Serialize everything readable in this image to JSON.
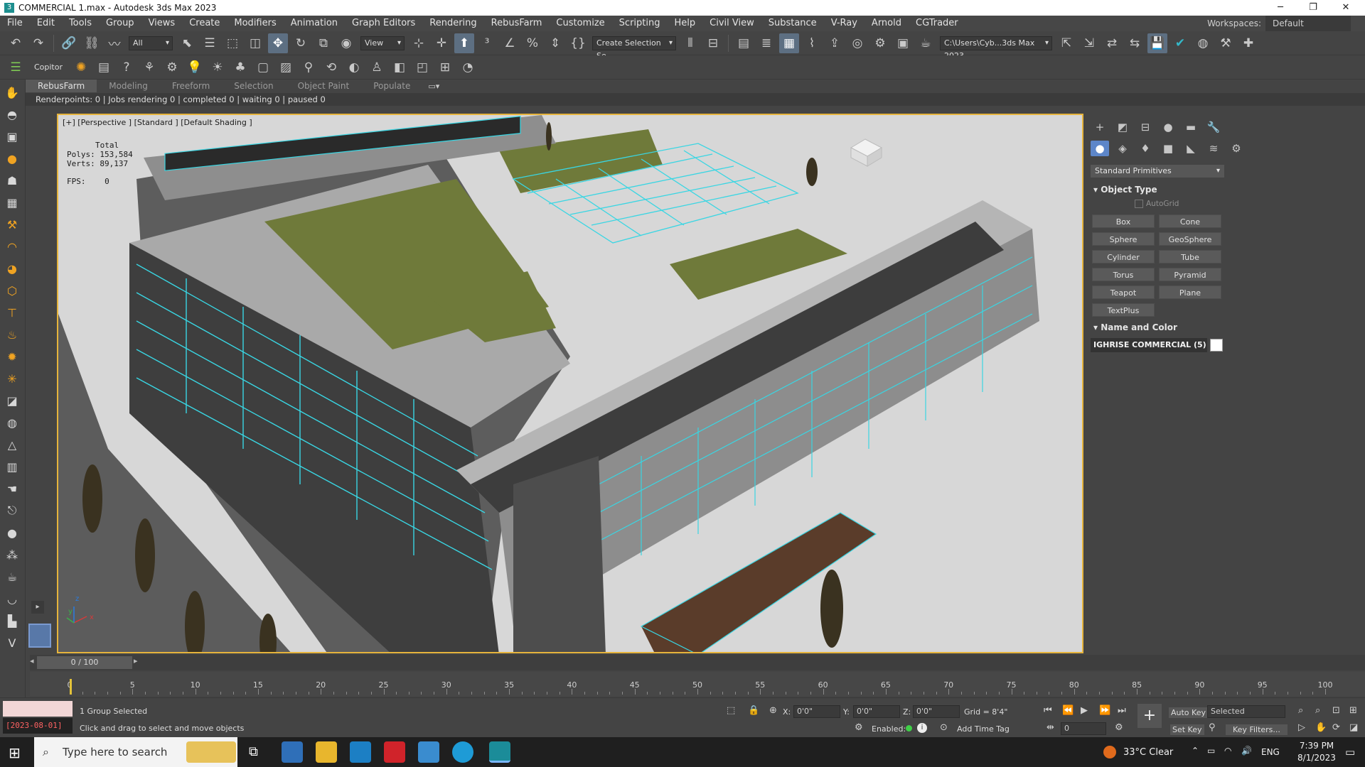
{
  "window": {
    "title": "COMMERCIAL 1.max - Autodesk 3ds Max 2023",
    "minimize_glyph": "─",
    "restore_glyph": "❐",
    "close_glyph": "✕"
  },
  "menu": {
    "items": [
      "File",
      "Edit",
      "Tools",
      "Group",
      "Views",
      "Create",
      "Modifiers",
      "Animation",
      "Graph Editors",
      "Rendering",
      "RebusFarm",
      "Customize",
      "Scripting",
      "Help",
      "Civil View",
      "Substance",
      "V-Ray",
      "Arnold",
      "CGTrader"
    ],
    "workspaces_label": "Workspaces:",
    "workspaces_value": "Default"
  },
  "main_toolbar": {
    "selection_filter": "All",
    "ref_coord": "View",
    "named_selection": "Create Selection Se",
    "project_path": "C:\\Users\\Cyb...3ds Max 2023"
  },
  "secondary_toolbar": {
    "copitor_label": "Copitor"
  },
  "ribbon": {
    "tabs": [
      "RebusFarm",
      "Modeling",
      "Freeform",
      "Selection",
      "Object Paint",
      "Populate"
    ],
    "active_tab": "RebusFarm",
    "renderpoints_text": "Renderpoints: 0 | Jobs rendering 0 | completed 0 | waiting 0 | paused 0"
  },
  "viewport": {
    "label": "[+] [Perspective ] [Standard ] [Default Shading ]",
    "stats_total": "Total",
    "stats_polys_label": "Polys:",
    "stats_polys": "153,584",
    "stats_verts_label": "Verts:",
    "stats_verts": "89,137",
    "fps_label": "FPS:",
    "fps_value": "0",
    "axis_x": "x",
    "axis_y": "y",
    "axis_z": "z"
  },
  "command_panel": {
    "category": "Standard Primitives",
    "object_type_title": "Object Type",
    "autogrid_label": "AutoGrid",
    "primitives": [
      "Box",
      "Cone",
      "Sphere",
      "GeoSphere",
      "Cylinder",
      "Tube",
      "Torus",
      "Pyramid",
      "Teapot",
      "Plane",
      "TextPlus"
    ],
    "name_color_title": "Name and Color",
    "object_name": "IGHRISE COMMERCIAL (5)",
    "object_color": "#ffffff"
  },
  "timeline": {
    "frame_display": "0 / 100",
    "ticks": [
      0,
      5,
      10,
      15,
      20,
      25,
      30,
      35,
      40,
      45,
      50,
      55,
      60,
      65,
      70,
      75,
      80,
      85,
      90,
      95,
      100
    ]
  },
  "statusbar": {
    "date_text": "[2023-08-01]",
    "selection_status": "1 Group Selected",
    "prompt": "Click and drag to select and move objects",
    "x_label": "X:",
    "x_value": "0'0\"",
    "y_label": "Y:",
    "y_value": "0'0\"",
    "z_label": "Z:",
    "z_value": "0'0\"",
    "grid": "Grid = 8'4\"",
    "enabled_label": "Enabled:",
    "add_time_tag": "Add Time Tag",
    "auto_key": "Auto Key",
    "set_key": "Set Key",
    "key_mode": "Selected",
    "key_filters": "Key Filters...",
    "frame_field": "0"
  },
  "taskbar": {
    "search_placeholder": "Type here to search",
    "weather": "33°C  Clear",
    "language": "ENG",
    "time": "7:39 PM",
    "date": "8/1/2023"
  }
}
